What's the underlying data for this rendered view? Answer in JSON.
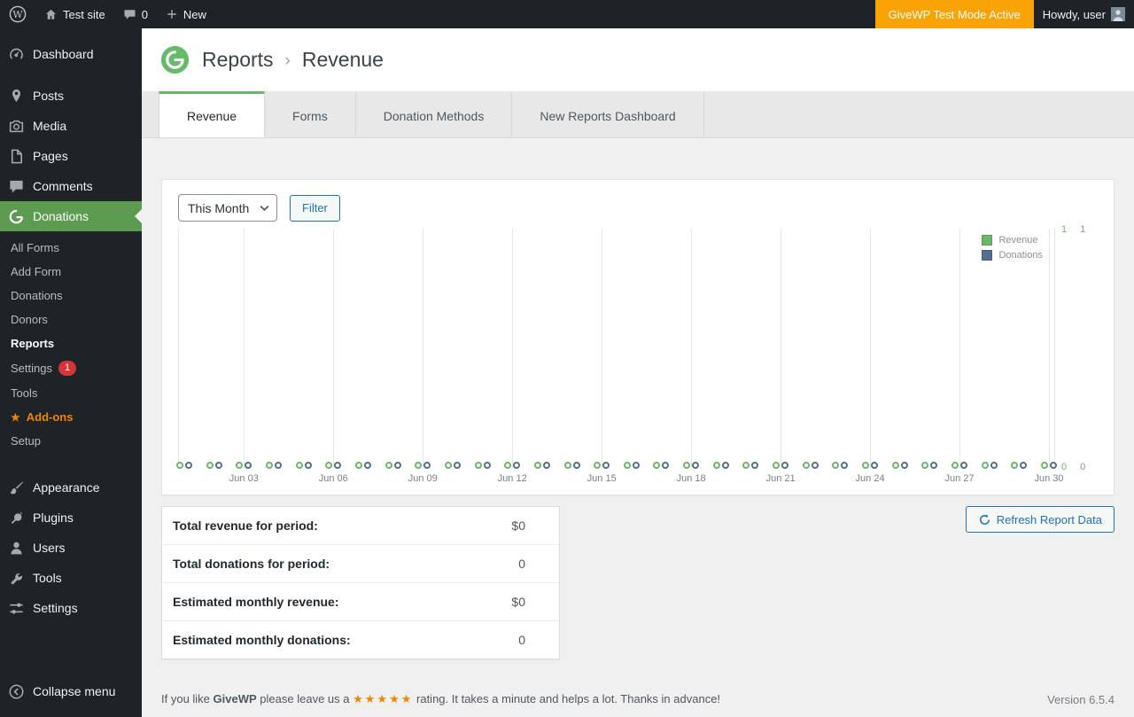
{
  "colors": {
    "brand_green": "#66bb6a",
    "menu_active_green": "#5d9c50",
    "revenue_green": "#69b868",
    "donations_blue": "#556e8f",
    "wp_blue": "#2271b1",
    "test_mode_orange": "#f9a306",
    "addons_orange": "#f18500",
    "badge_red": "#d63638"
  },
  "admin_bar": {
    "site_name": "Test site",
    "comments_count": "0",
    "new_label": "New",
    "test_mode_badge": "GiveWP Test Mode Active",
    "howdy_text": "Howdy, user"
  },
  "sidebar": {
    "items": [
      {
        "label": "Dashboard"
      },
      {
        "label": "Posts"
      },
      {
        "label": "Media"
      },
      {
        "label": "Pages"
      },
      {
        "label": "Comments"
      },
      {
        "label": "Donations"
      },
      {
        "label": "Appearance"
      },
      {
        "label": "Plugins"
      },
      {
        "label": "Users"
      },
      {
        "label": "Tools"
      },
      {
        "label": "Settings"
      },
      {
        "label": "Collapse menu"
      }
    ],
    "submenu": [
      {
        "label": "All Forms"
      },
      {
        "label": "Add Form"
      },
      {
        "label": "Donations"
      },
      {
        "label": "Donors"
      },
      {
        "label": "Reports"
      },
      {
        "label": "Settings",
        "badge": "1"
      },
      {
        "label": "Tools"
      },
      {
        "label": "Add-ons"
      },
      {
        "label": "Setup"
      }
    ]
  },
  "page_header": {
    "breadcrumb_root": "Reports",
    "breadcrumb_separator": "›",
    "breadcrumb_current": "Revenue"
  },
  "tabs": [
    {
      "label": "Revenue"
    },
    {
      "label": "Forms"
    },
    {
      "label": "Donation Methods"
    },
    {
      "label": "New Reports Dashboard"
    }
  ],
  "filters": {
    "period_selected": "This Month",
    "filter_button_label": "Filter"
  },
  "chart_data": {
    "type": "line",
    "title": "",
    "x": [
      "Jun 01",
      "Jun 02",
      "Jun 03",
      "Jun 04",
      "Jun 05",
      "Jun 06",
      "Jun 07",
      "Jun 08",
      "Jun 09",
      "Jun 10",
      "Jun 11",
      "Jun 12",
      "Jun 13",
      "Jun 14",
      "Jun 15",
      "Jun 16",
      "Jun 17",
      "Jun 18",
      "Jun 19",
      "Jun 20",
      "Jun 21",
      "Jun 22",
      "Jun 23",
      "Jun 24",
      "Jun 25",
      "Jun 26",
      "Jun 27",
      "Jun 28",
      "Jun 29",
      "Jun 30"
    ],
    "x_tick_labels": [
      "Jun 03",
      "Jun 06",
      "Jun 09",
      "Jun 12",
      "Jun 15",
      "Jun 18",
      "Jun 21",
      "Jun 24",
      "Jun 27",
      "Jun 30"
    ],
    "series": [
      {
        "name": "Revenue",
        "color": "#69b868",
        "values": [
          0,
          0,
          0,
          0,
          0,
          0,
          0,
          0,
          0,
          0,
          0,
          0,
          0,
          0,
          0,
          0,
          0,
          0,
          0,
          0,
          0,
          0,
          0,
          0,
          0,
          0,
          0,
          0,
          0,
          0
        ]
      },
      {
        "name": "Donations",
        "color": "#556e8f",
        "values": [
          0,
          0,
          0,
          0,
          0,
          0,
          0,
          0,
          0,
          0,
          0,
          0,
          0,
          0,
          0,
          0,
          0,
          0,
          0,
          0,
          0,
          0,
          0,
          0,
          0,
          0,
          0,
          0,
          0,
          0
        ]
      }
    ],
    "right_axis": {
      "revenue": {
        "max": "1",
        "min": "0"
      },
      "donations": {
        "max": "1",
        "min": "0"
      }
    },
    "legend": [
      "Revenue",
      "Donations"
    ],
    "legend_position": "top-right",
    "grid": "vertical-only",
    "ylim": [
      0,
      1
    ]
  },
  "summary": {
    "rows": [
      {
        "label": "Total revenue for period:",
        "value": "$0"
      },
      {
        "label": "Total donations for period:",
        "value": "0"
      },
      {
        "label": "Estimated monthly revenue:",
        "value": "$0"
      },
      {
        "label": "Estimated monthly donations:",
        "value": "0"
      }
    ]
  },
  "actions": {
    "refresh_button_label": "Refresh Report Data"
  },
  "footer": {
    "text_prefix": "If you like",
    "brand": "GiveWP",
    "text_middle": "please leave us a",
    "stars": "★★★★★",
    "text_suffix": "rating. It takes a minute and helps a lot. Thanks in advance!",
    "version": "Version 6.5.4"
  }
}
